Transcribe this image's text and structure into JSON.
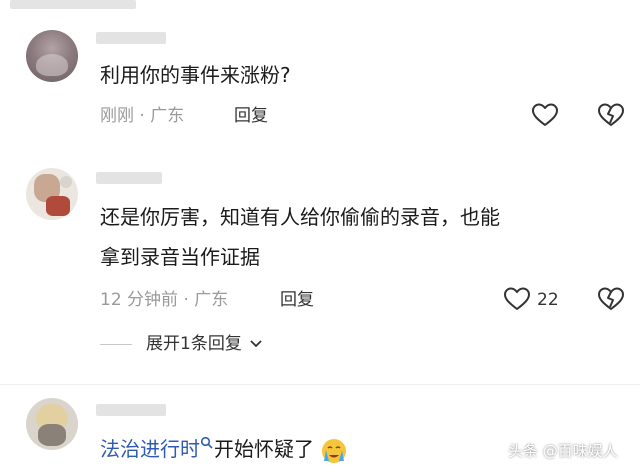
{
  "comments": [
    {
      "text": "利用你的事件来涨粉?",
      "time": "刚刚",
      "location": "广东",
      "reply_label": "回复"
    },
    {
      "text_line1": "还是你厉害，知道有人给你偷偷的录音，也能",
      "text_line2": "拿到录音当作证据",
      "time": "12 分钟前",
      "location": "广东",
      "reply_label": "回复",
      "like_count": "22",
      "expand_label": "展开1条回复"
    },
    {
      "topic": "法治进行时",
      "text": "开始怀疑了"
    }
  ],
  "meta_separator": "·",
  "watermark": "头条 @百味娱人",
  "icons": [
    "heart-icon",
    "broken-heart-icon",
    "search-icon",
    "chevron-down-icon",
    "crying-emoji-icon"
  ]
}
